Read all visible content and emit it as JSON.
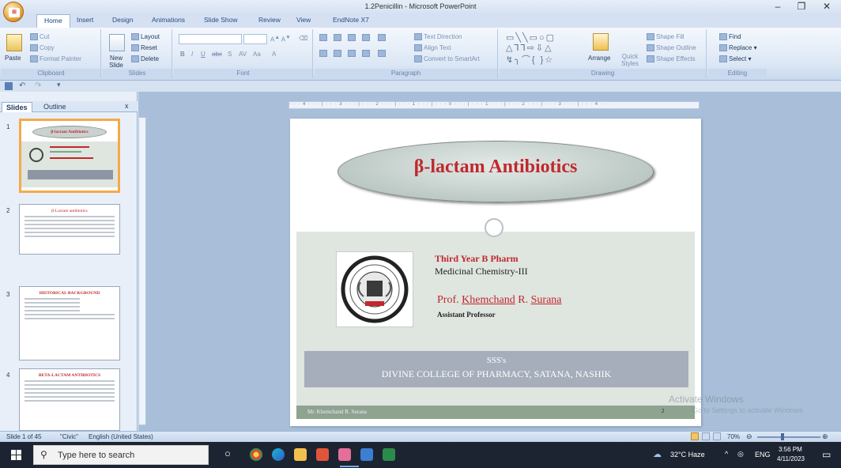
{
  "window": {
    "title": "1.2Penicillin - Microsoft PowerPoint",
    "min_icon": "minimize-icon",
    "restore_icon": "restore-icon",
    "close_icon": "close-icon"
  },
  "ribbon": {
    "tabs": [
      "Home",
      "Insert",
      "Design",
      "Animations",
      "Slide Show",
      "Review",
      "View",
      "EndNote X7"
    ],
    "active_tab": "Home",
    "groups": {
      "clipboard": {
        "label": "Clipboard",
        "paste": "Paste",
        "cut": "Cut",
        "copy": "Copy",
        "format_painter": "Format Painter"
      },
      "slides": {
        "label": "Slides",
        "new_slide": "New Slide",
        "layout": "Layout",
        "reset": "Reset",
        "delete": "Delete"
      },
      "font": {
        "label": "Font"
      },
      "paragraph": {
        "label": "Paragraph",
        "text_direction": "Text Direction",
        "align_text": "Align Text",
        "convert_smartart": "Convert to SmartArt"
      },
      "drawing": {
        "label": "Drawing",
        "arrange": "Arrange",
        "quick_styles": "Quick Styles",
        "shape_fill": "Shape Fill",
        "shape_outline": "Shape Outline",
        "shape_effects": "Shape Effects"
      },
      "editing": {
        "label": "Editing",
        "find": "Find",
        "replace": "Replace",
        "select": "Select"
      }
    }
  },
  "left_panel": {
    "tabs": [
      "Slides",
      "Outline"
    ],
    "close": "x",
    "thumbnails": [
      {
        "num": "1",
        "title": "β-lactam Antibiotics"
      },
      {
        "num": "2",
        "title": "β-Lactam antibiotics"
      },
      {
        "num": "3",
        "title": "HISTORICAL BACKGROUND"
      },
      {
        "num": "4",
        "title": "BETA-LACTAM ANTIBIOTICS"
      }
    ]
  },
  "slide": {
    "title": "β-lactam Antibiotics",
    "course": "Third Year B Pharm",
    "subject": "Medicinal Chemistry-III",
    "prof_prefix": "Prof.",
    "prof_first": "Khemchand",
    "prof_mid": "R.",
    "prof_last": "Surana",
    "designation": "Assistant Professor",
    "band_line1": "SSS's",
    "band_line2": "DIVINE COLLEGE OF PHARMACY, SATANA, NASHIK",
    "footer_name": "Mr. Khemchand R. Surana",
    "page_num": "2",
    "logo_text": "DIVINE COLLEGE OF PHARMACY"
  },
  "statusbar": {
    "slide_info": "Slide 1 of 45",
    "theme": "\"Civic\"",
    "language": "English (United States)",
    "zoom": "70%"
  },
  "watermark": {
    "line1": "Activate Windows",
    "line2": "Go to Settings to activate Windows."
  },
  "taskbar": {
    "search_placeholder": "Type here to search",
    "weather": "32°C  Haze",
    "lang": "ENG",
    "time": "3:56 PM",
    "date": "4/11/2023"
  }
}
